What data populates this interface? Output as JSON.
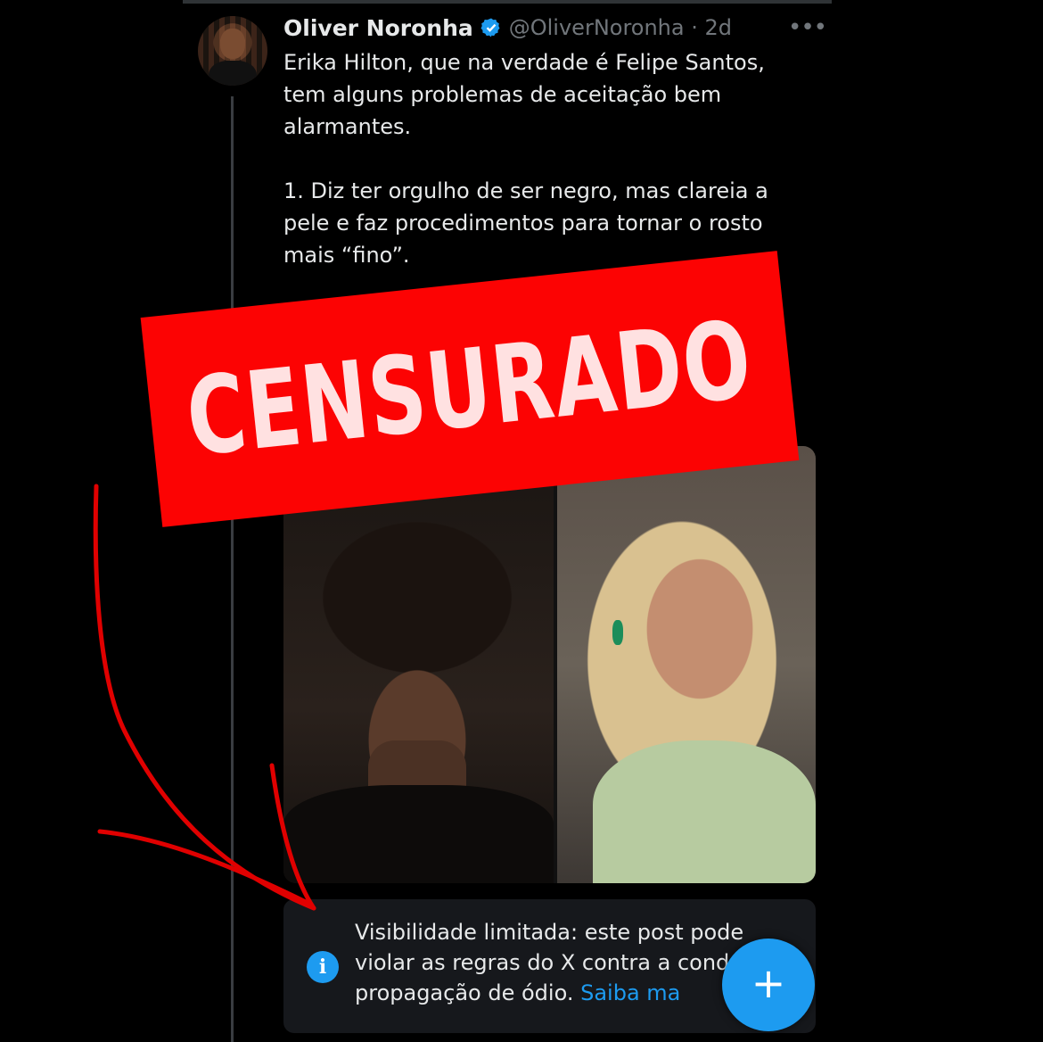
{
  "tweet": {
    "author_name": "Oliver Noronha",
    "handle_time": "@OliverNoronha · 2d",
    "more_icon": "•••",
    "text_p1": "Erika Hilton, que na verdade é Felipe Santos, tem alguns problemas de aceitação bem alarmantes.",
    "text_p2": "1. Diz ter orgulho de ser negro, mas clareia a pele e faz procedimentos para tornar o rosto mais “fino”."
  },
  "notice": {
    "icon": "i",
    "text": "Visibilidade limitada: este post pode violar as regras do X contra a cond de propagação de ódio.",
    "link": "Saiba ma"
  },
  "fab": {
    "label": "+"
  },
  "overlay": {
    "stamp": "CENSURADO"
  },
  "colors": {
    "accent": "#1d9bf0",
    "stamp": "#fc0303",
    "arrow": "#e00000"
  }
}
